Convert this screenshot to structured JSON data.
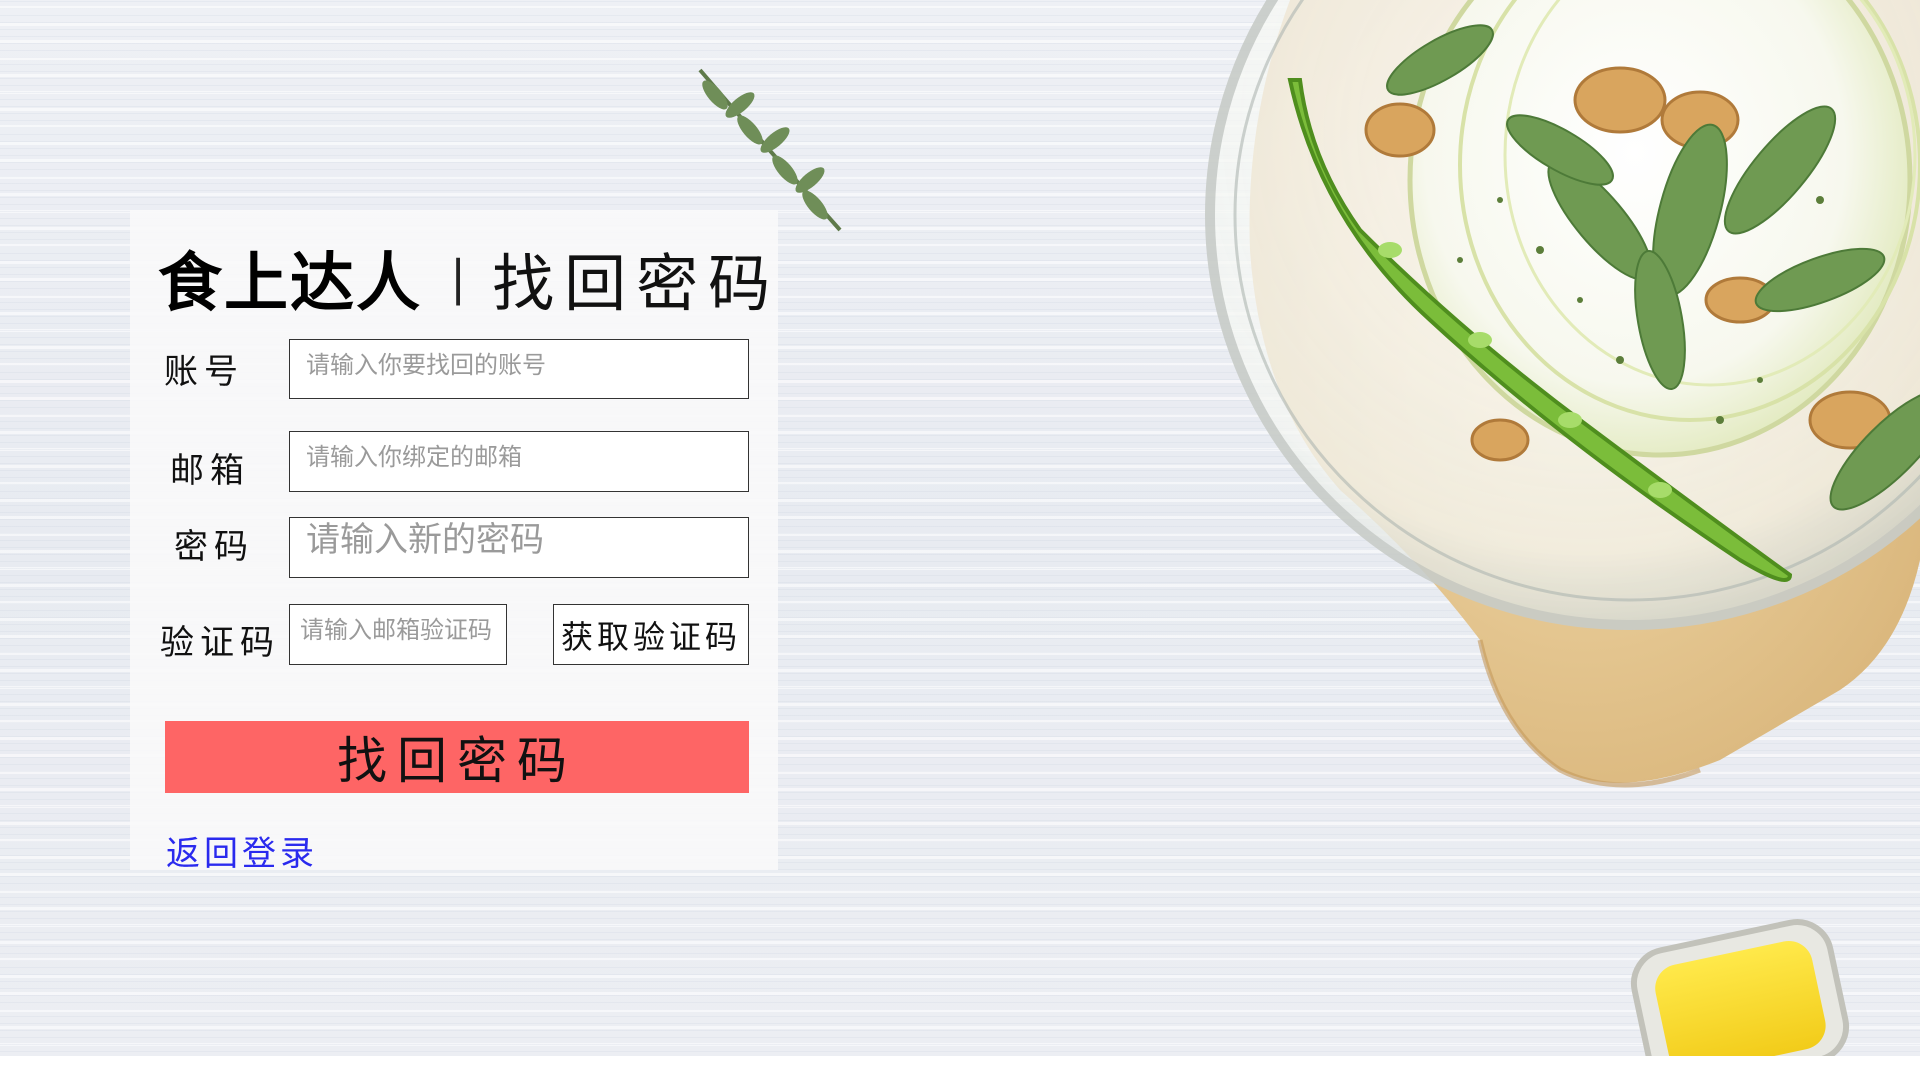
{
  "header": {
    "brand": "食上达人",
    "separator": "|",
    "title": "找回密码"
  },
  "form": {
    "account": {
      "label": "账号",
      "placeholder": "请输入你要找回的账号",
      "value": ""
    },
    "email": {
      "label": "邮箱",
      "placeholder": "请输入你绑定的邮箱",
      "value": ""
    },
    "password": {
      "label": "密码",
      "placeholder": "请输入新的密码",
      "value": ""
    },
    "code": {
      "label": "验证码",
      "placeholder": "请输入邮箱验证码",
      "value": "",
      "button_label": "获取验证码"
    },
    "submit_label": "找回密码",
    "back_link": "返回登录"
  },
  "colors": {
    "submit_button": "#fe6565",
    "link": "#2a2aee",
    "background": "#eceef3"
  },
  "icons": {
    "decoration": "food-plate-illustration",
    "herb": "herb-sprig-illustration",
    "butter": "butter-dish-illustration"
  }
}
